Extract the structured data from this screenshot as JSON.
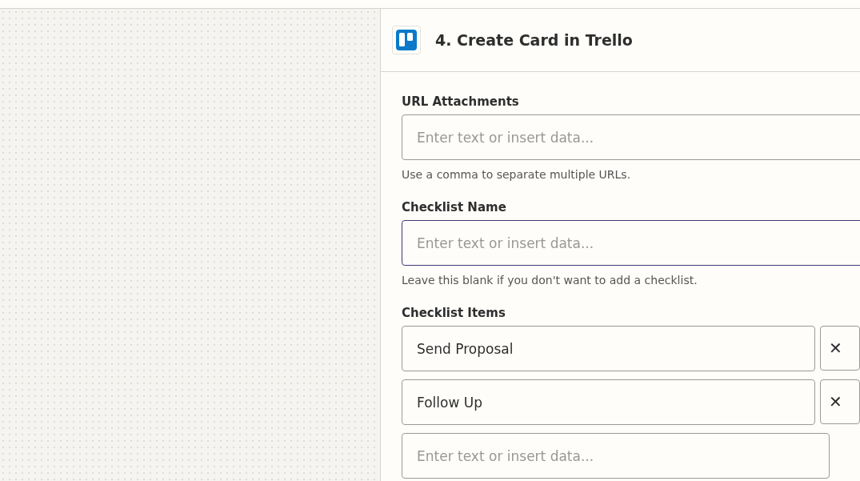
{
  "panel": {
    "step_title": "4. Create Card in Trello",
    "fields": [
      {
        "label": "URL Attachments",
        "placeholder": "Enter text or insert data...",
        "help": "Use a comma to separate multiple URLs.",
        "focused": false
      },
      {
        "label": "Checklist Name",
        "placeholder": "Enter text or insert data...",
        "help": "Leave this blank if you don't want to add a checklist.",
        "focused": true
      }
    ],
    "checklist_items": {
      "label": "Checklist Items",
      "items": [
        {
          "value": "Send Proposal",
          "remove": "✕"
        },
        {
          "value": "Follow Up",
          "remove": "✕"
        },
        {
          "placeholder": "Enter text or insert data..."
        }
      ]
    }
  }
}
